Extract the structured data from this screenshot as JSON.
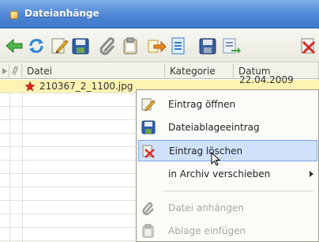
{
  "window": {
    "title": "Dateianhänge"
  },
  "toolbar": {
    "buttons": [
      {
        "icon": "back-arrow-icon"
      },
      {
        "icon": "refresh-icon"
      },
      {
        "icon": "edit-icon"
      },
      {
        "icon": "save-icon"
      },
      {
        "icon": "paperclip-icon"
      },
      {
        "icon": "clipboard-icon"
      },
      {
        "icon": "arrow-out-icon"
      },
      {
        "icon": "document-icon"
      },
      {
        "icon": "disk-icon"
      },
      {
        "icon": "export-icon"
      },
      {
        "icon": "delete-icon"
      }
    ]
  },
  "columns": {
    "datei": "Datei",
    "kategorie": "Kategorie",
    "datum": "Datum"
  },
  "rows": [
    {
      "name": "210367_2_1100.jpg",
      "date": "22.04.2009",
      "selected": true
    }
  ],
  "context_menu": {
    "items": [
      {
        "label": "Eintrag öffnen",
        "icon": "edit-icon",
        "enabled": true
      },
      {
        "label": "Dateiablageeintrag",
        "icon": "save-icon",
        "enabled": true
      },
      {
        "label": "Eintrag löschen",
        "icon": "delete-icon",
        "enabled": true,
        "hovered": true
      },
      {
        "label": "in Archiv verschieben",
        "icon": "",
        "enabled": true,
        "submenu": true
      },
      {
        "label": "Datei anhängen",
        "icon": "paperclip-icon",
        "enabled": false
      },
      {
        "label": "Ablage einfügen",
        "icon": "clipboard-icon",
        "enabled": false
      }
    ]
  },
  "colors": {
    "title_bar": "#4d86d4",
    "selected_row": "#fff3b3",
    "menu_hover": "#cfe1fb"
  }
}
